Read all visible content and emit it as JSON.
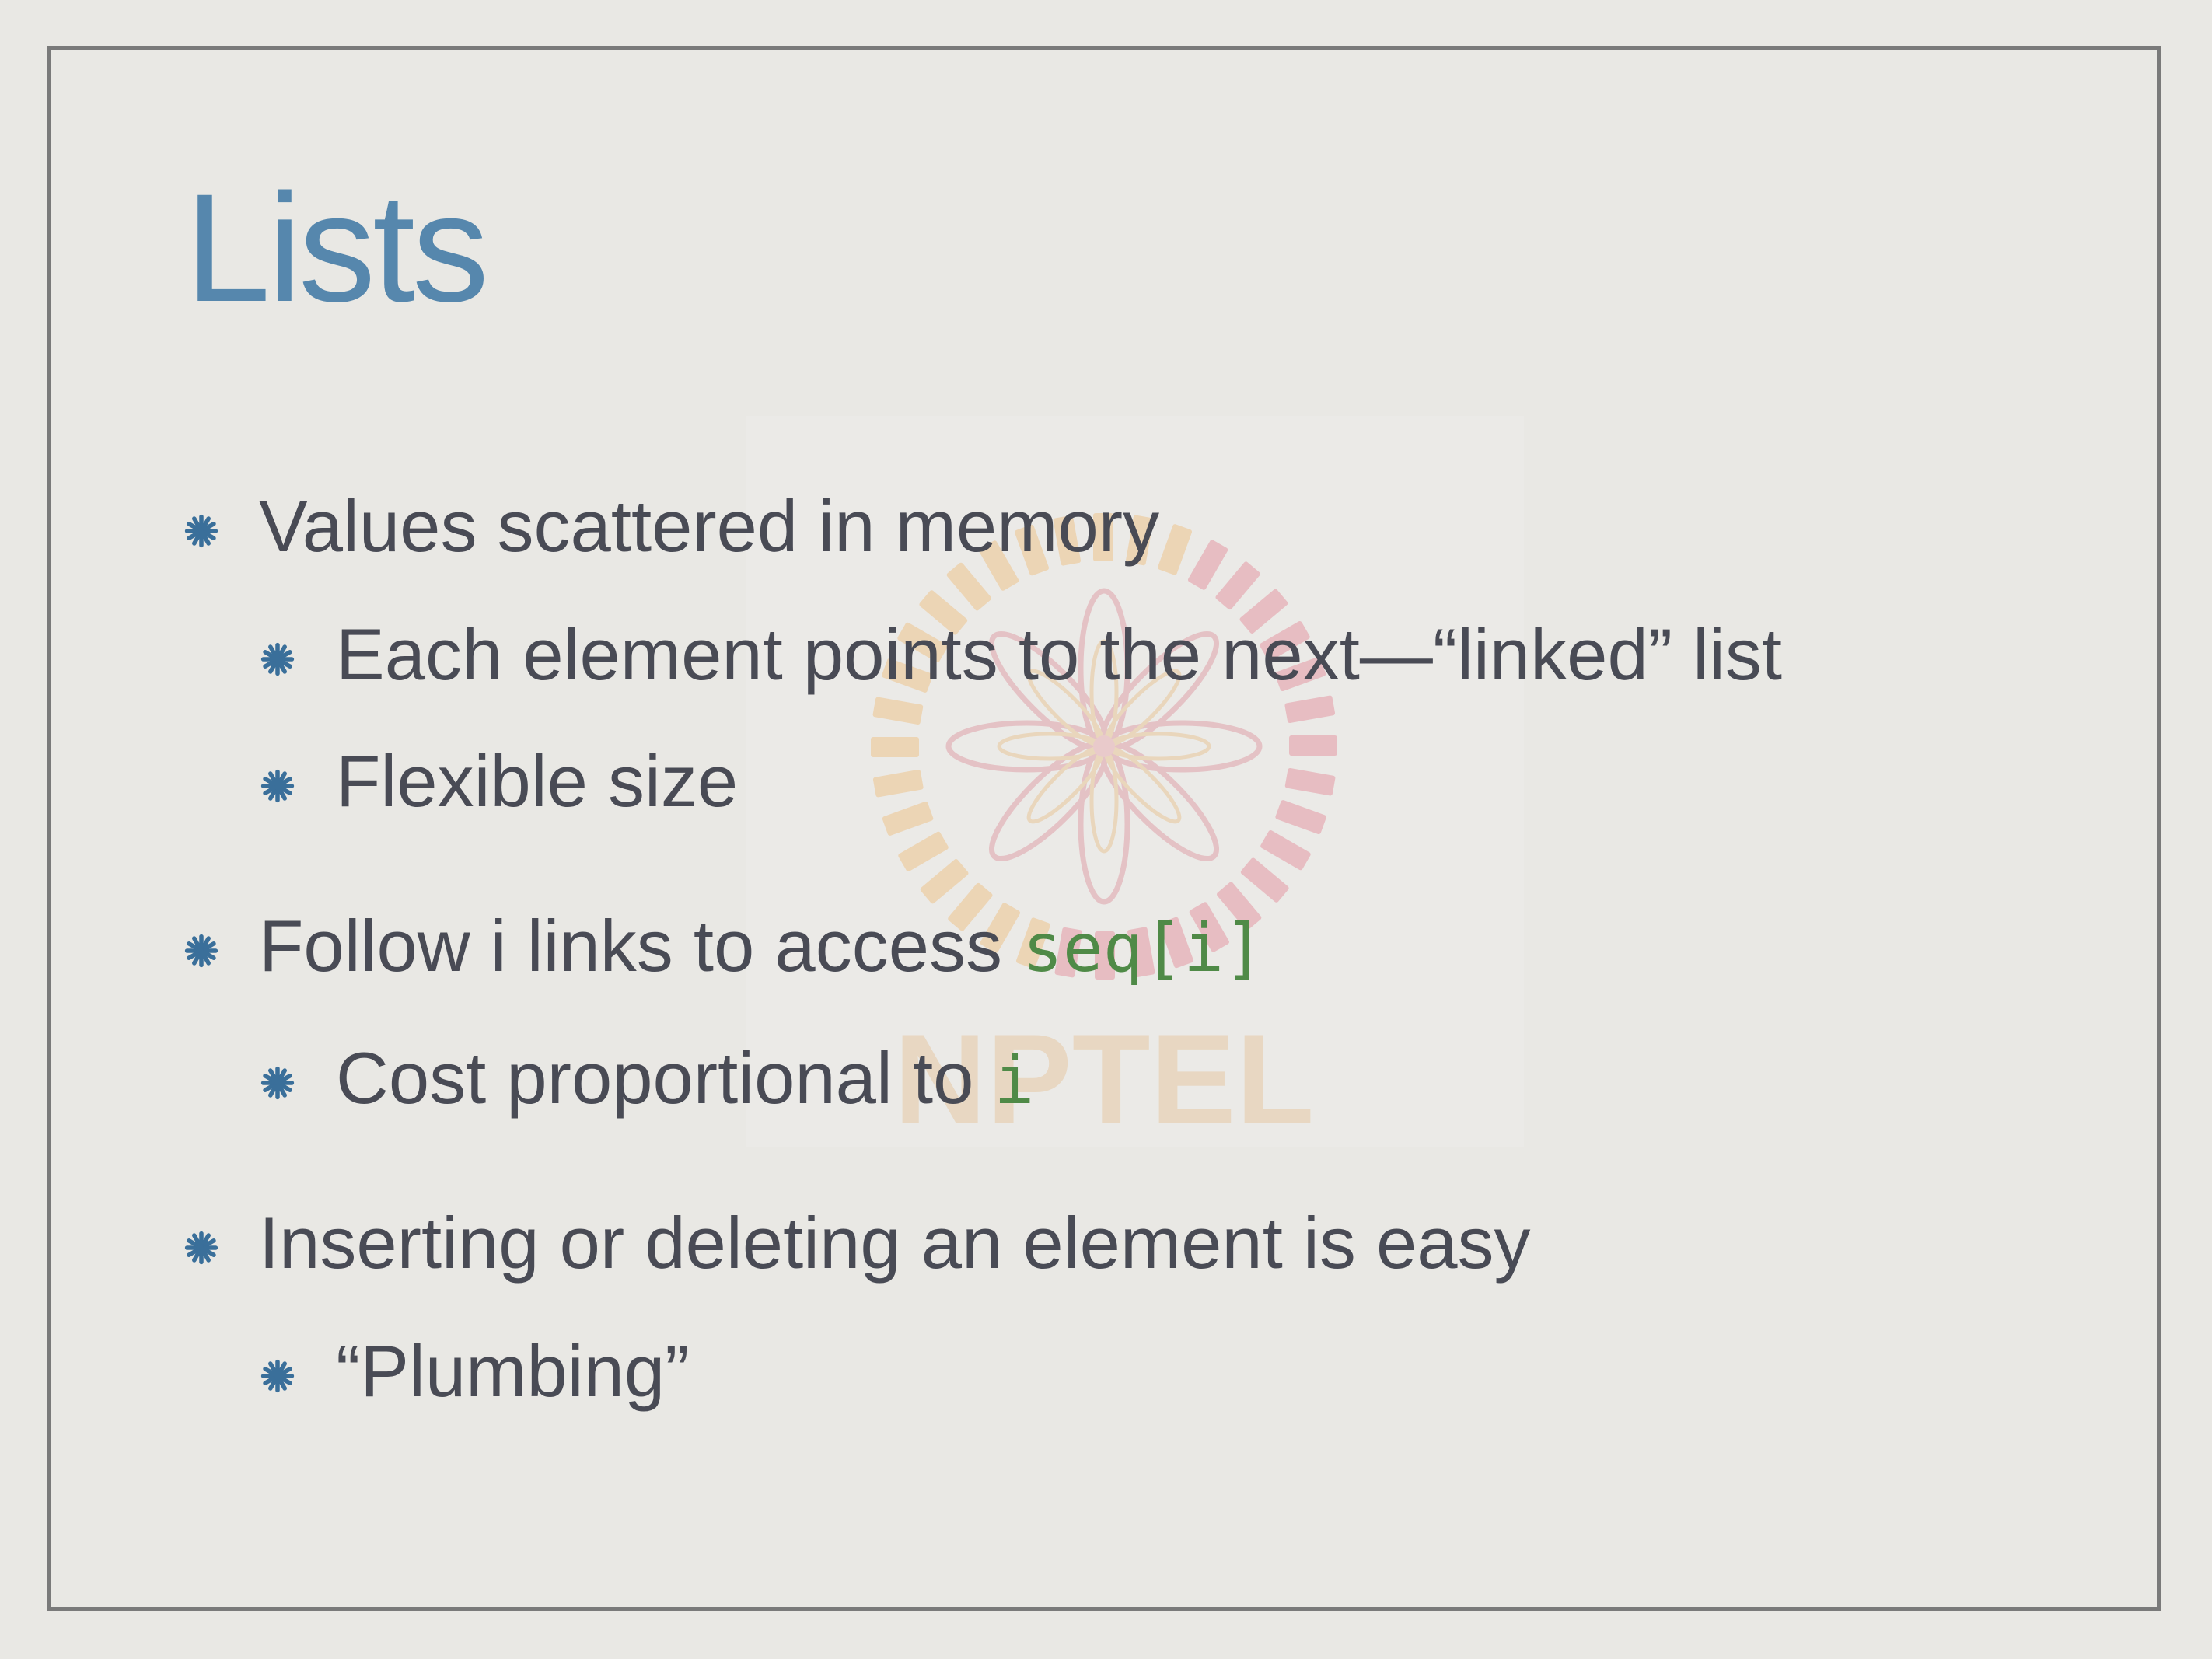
{
  "slide": {
    "title": "Lists",
    "bullets": [
      {
        "level": 1,
        "text": "Values scattered in memory"
      },
      {
        "level": 2,
        "text": "Each element points to the next—“linked” list"
      },
      {
        "level": 2,
        "text": "Flexible size"
      },
      {
        "level": 1,
        "text": "Follow i links to access ",
        "code": "seq[i]"
      },
      {
        "level": 2,
        "text": "Cost proportional to ",
        "code": "i"
      },
      {
        "level": 1,
        "text": "Inserting or deleting an element is easy"
      },
      {
        "level": 2,
        "text": "“Plumbing”"
      }
    ],
    "watermark_text": "NPTEL",
    "colors": {
      "background": "#e9e8e4",
      "title": "#5687ad",
      "body_text": "#494b55",
      "code": "#4f8a47",
      "bullet_star": "#3a6f9a",
      "frame": "#7a7a7a"
    },
    "icons": {
      "bullet": "asterisk-bullet-icon",
      "watermark": "nptel-logo"
    }
  }
}
